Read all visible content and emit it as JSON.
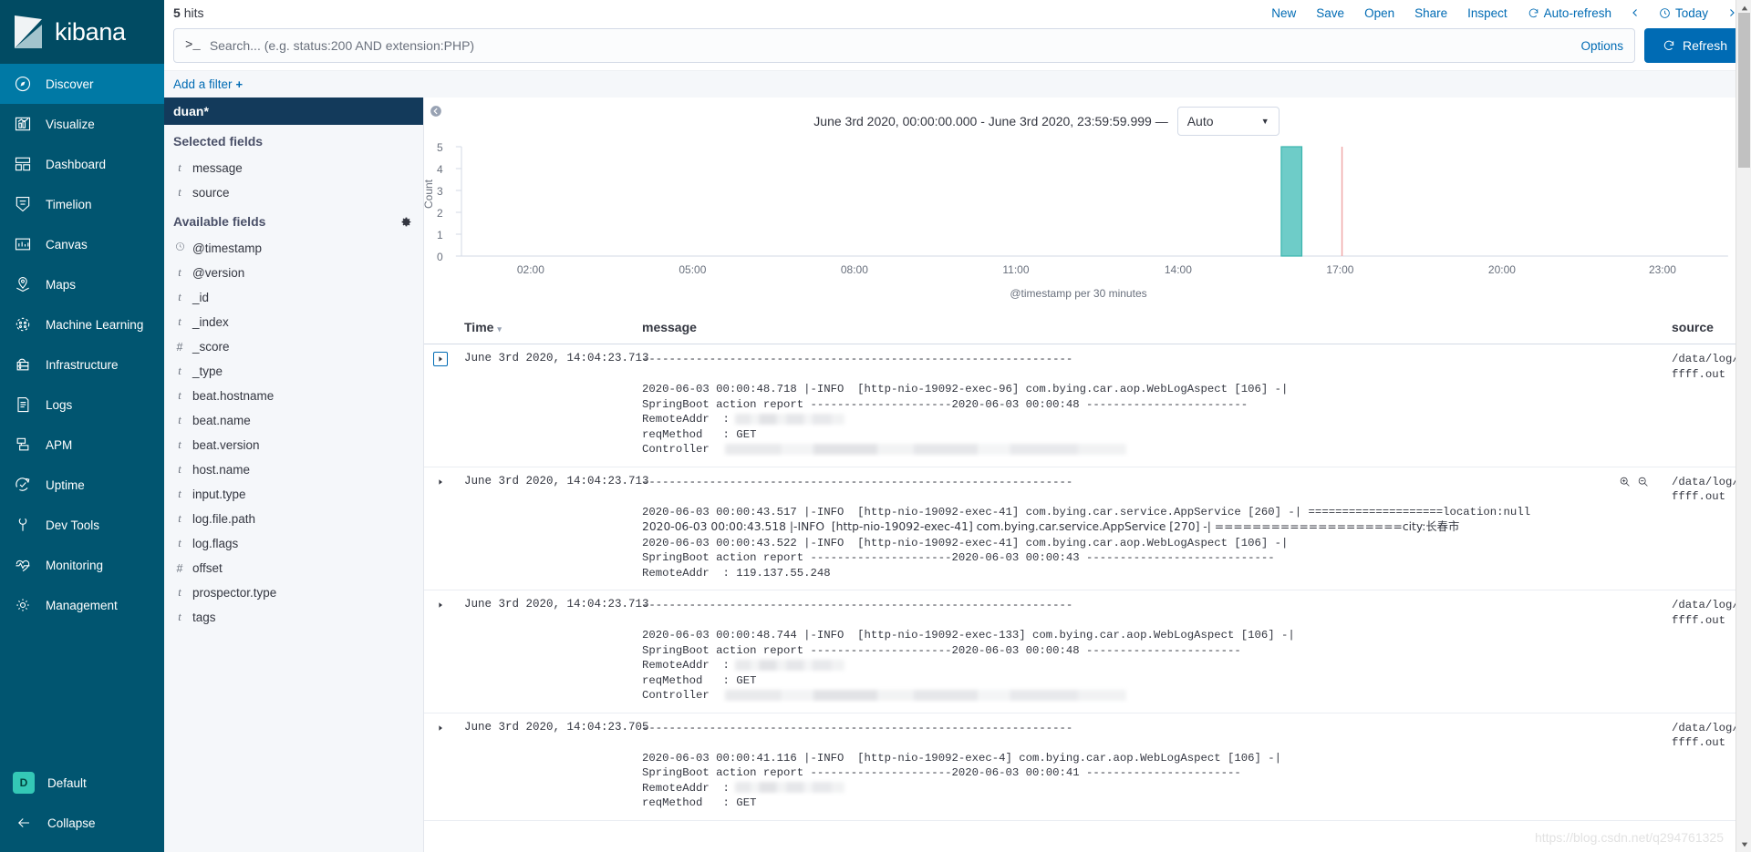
{
  "brand": {
    "name": "kibana"
  },
  "sidebar": {
    "items": [
      {
        "label": "Discover",
        "icon": "compass-icon",
        "active": true
      },
      {
        "label": "Visualize",
        "icon": "bar-chart-icon",
        "active": false
      },
      {
        "label": "Dashboard",
        "icon": "dashboard-icon",
        "active": false
      },
      {
        "label": "Timelion",
        "icon": "timelion-icon",
        "active": false
      },
      {
        "label": "Canvas",
        "icon": "canvas-icon",
        "active": false
      },
      {
        "label": "Maps",
        "icon": "map-marker-icon",
        "active": false
      },
      {
        "label": "Machine Learning",
        "icon": "machine-learning-icon",
        "active": false
      },
      {
        "label": "Infrastructure",
        "icon": "infrastructure-icon",
        "active": false
      },
      {
        "label": "Logs",
        "icon": "logs-icon",
        "active": false
      },
      {
        "label": "APM",
        "icon": "apm-icon",
        "active": false
      },
      {
        "label": "Uptime",
        "icon": "uptime-icon",
        "active": false
      },
      {
        "label": "Dev Tools",
        "icon": "wrench-icon",
        "active": false
      },
      {
        "label": "Monitoring",
        "icon": "monitoring-icon",
        "active": false
      },
      {
        "label": "Management",
        "icon": "gear-icon",
        "active": false
      }
    ],
    "space": {
      "badge": "D",
      "label": "Default"
    },
    "collapse": {
      "label": "Collapse"
    }
  },
  "topbar": {
    "hits_count": "5",
    "hits_label": "hits",
    "actions": [
      "New",
      "Save",
      "Open",
      "Share",
      "Inspect"
    ],
    "auto_refresh": "Auto-refresh",
    "time_picker": "Today"
  },
  "search": {
    "placeholder": "Search... (e.g. status:200 AND extension:PHP)",
    "value": "",
    "prompt": ">_",
    "options_label": "Options",
    "refresh_label": "Refresh"
  },
  "filters": {
    "add_filter_label": "Add a filter",
    "plus": "+"
  },
  "fields_panel": {
    "index_pattern": "duan*",
    "selected_title": "Selected fields",
    "selected": [
      {
        "label": "message",
        "type": "t"
      },
      {
        "label": "source",
        "type": "t"
      }
    ],
    "available_title": "Available fields",
    "available": [
      {
        "label": "@timestamp",
        "type": "clock"
      },
      {
        "label": "@version",
        "type": "t"
      },
      {
        "label": "_id",
        "type": "t"
      },
      {
        "label": "_index",
        "type": "t"
      },
      {
        "label": "_score",
        "type": "#"
      },
      {
        "label": "_type",
        "type": "t"
      },
      {
        "label": "beat.hostname",
        "type": "t"
      },
      {
        "label": "beat.name",
        "type": "t"
      },
      {
        "label": "beat.version",
        "type": "t"
      },
      {
        "label": "host.name",
        "type": "t"
      },
      {
        "label": "input.type",
        "type": "t"
      },
      {
        "label": "log.file.path",
        "type": "t"
      },
      {
        "label": "log.flags",
        "type": "t"
      },
      {
        "label": "offset",
        "type": "#"
      },
      {
        "label": "prospector.type",
        "type": "t"
      },
      {
        "label": "tags",
        "type": "t"
      }
    ]
  },
  "histogram": {
    "time_range_text": "June 3rd 2020, 00:00:00.000 - June 3rd 2020, 23:59:59.999 —",
    "interval": "Auto"
  },
  "chart_data": {
    "type": "bar",
    "title": "",
    "xlabel": "@timestamp per 30 minutes",
    "ylabel": "Count",
    "ylim": [
      0,
      5
    ],
    "yticks": [
      0,
      1,
      2,
      3,
      4,
      5
    ],
    "xticks": [
      "02:00",
      "05:00",
      "08:00",
      "11:00",
      "14:00",
      "17:00",
      "20:00",
      "23:00"
    ],
    "x_range": [
      "00:00",
      "24:00"
    ],
    "grid": false,
    "bar_color": "#6eccc8",
    "bar_border_color": "#3ab5ae",
    "marker_color": "#f0a6a6",
    "categories": [
      "14:00"
    ],
    "values": [
      5
    ],
    "annotations": [
      {
        "type": "vertical-line",
        "x": "15:30",
        "label": "current time marker"
      }
    ]
  },
  "doc_table": {
    "columns": [
      {
        "key": "time",
        "label": "Time",
        "sorted": true
      },
      {
        "key": "message",
        "label": "message"
      },
      {
        "key": "source",
        "label": "source"
      }
    ],
    "rows": [
      {
        "time": "June 3rd 2020, 14:04:23.713",
        "expanded_selected": true,
        "has_zoom_icons": false,
        "source": "/data/log/ffff.out",
        "message_lines": [
          {
            "text": "----------------------------------------------------------------"
          },
          {
            "text": ""
          },
          {
            "text": "2020-06-03 00:00:48.718 |-INFO  [http-nio-19092-exec-96] com.bying.car.aop.WebLogAspect [106] -|"
          },
          {
            "text": "SpringBoot action report ---------------------2020-06-03 00:00:48 ------------------------"
          },
          {
            "text": "RemoteAddr  :",
            "redacted": 120
          },
          {
            "text": "reqMethod   : GET"
          },
          {
            "text": "Controller  ",
            "redacted": 440
          }
        ]
      },
      {
        "time": "June 3rd 2020, 14:04:23.713",
        "expanded_selected": false,
        "has_zoom_icons": true,
        "source": "/data/log/ffff.out",
        "message_lines": [
          {
            "text": "----------------------------------------------------------------"
          },
          {
            "text": ""
          },
          {
            "text": "2020-06-03 00:00:43.517 |-INFO  [http-nio-19092-exec-41] com.bying.car.service.AppService [260] -| ====================location:null"
          },
          {
            "text": "2020-06-03 00:00:43.518 |-INFO  [http-nio-19092-exec-41] com.bying.car.service.AppService [270] -| ====================city:长春市"
          },
          {
            "text": "2020-06-03 00:00:43.522 |-INFO  [http-nio-19092-exec-41] com.bying.car.aop.WebLogAspect [106] -|"
          },
          {
            "text": "SpringBoot action report ---------------------2020-06-03 00:00:43 ----------------------------"
          },
          {
            "text": "RemoteAddr  : 119.137.55.248"
          }
        ]
      },
      {
        "time": "June 3rd 2020, 14:04:23.713",
        "expanded_selected": false,
        "has_zoom_icons": false,
        "source": "/data/log/ffff.out",
        "message_lines": [
          {
            "text": "----------------------------------------------------------------"
          },
          {
            "text": ""
          },
          {
            "text": "2020-06-03 00:00:48.744 |-INFO  [http-nio-19092-exec-133] com.bying.car.aop.WebLogAspect [106] -|"
          },
          {
            "text": "SpringBoot action report ---------------------2020-06-03 00:00:48 -----------------------"
          },
          {
            "text": "RemoteAddr  :",
            "redacted": 120
          },
          {
            "text": "reqMethod   : GET"
          },
          {
            "text": "Controller  ",
            "redacted": 440
          }
        ]
      },
      {
        "time": "June 3rd 2020, 14:04:23.705",
        "expanded_selected": false,
        "has_zoom_icons": false,
        "source": "/data/log/ffff.out",
        "message_lines": [
          {
            "text": "----------------------------------------------------------------"
          },
          {
            "text": ""
          },
          {
            "text": "2020-06-03 00:00:41.116 |-INFO  [http-nio-19092-exec-4] com.bying.car.aop.WebLogAspect [106] -|"
          },
          {
            "text": "SpringBoot action report ---------------------2020-06-03 00:00:41 -----------------------"
          },
          {
            "text": "RemoteAddr  :",
            "redacted": 120
          },
          {
            "text": "reqMethod   : GET"
          }
        ]
      }
    ]
  },
  "watermark": "https://blog.csdn.net/q294761325"
}
